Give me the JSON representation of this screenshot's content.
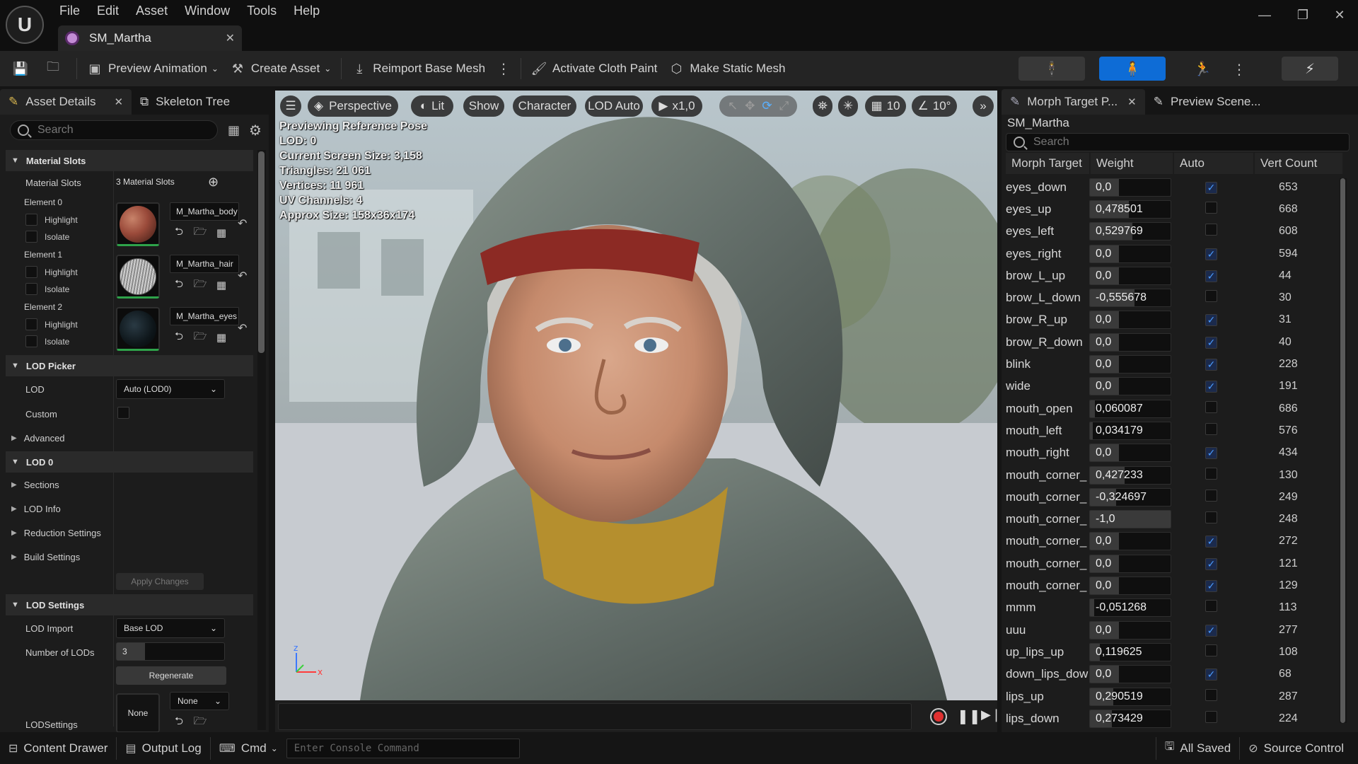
{
  "app": {
    "engine_logo": "U",
    "document_tab": "SM_Martha",
    "window_controls": [
      "minimize",
      "restore",
      "close"
    ]
  },
  "menu": [
    "File",
    "Edit",
    "Asset",
    "Window",
    "Tools",
    "Help"
  ],
  "toolbar": {
    "preview_animation": "Preview Animation",
    "create_asset": "Create Asset",
    "reimport": "Reimport Base Mesh",
    "cloth_paint": "Activate Cloth Paint",
    "make_static": "Make Static Mesh"
  },
  "left_tabs": {
    "details": "Asset Details",
    "skeleton": "Skeleton Tree"
  },
  "left_search_placeholder": "Search",
  "material_slots": {
    "section": "Material Slots",
    "label": "Material Slots",
    "value": "3 Material Slots",
    "elements": [
      {
        "label": "Element 0",
        "highlight": "Highlight",
        "isolate": "Isolate",
        "material": "M_Martha_body",
        "color": "#9a4a3a"
      },
      {
        "label": "Element 1",
        "highlight": "Highlight",
        "isolate": "Isolate",
        "material": "M_Martha_hair",
        "color": "#b8b8b8"
      },
      {
        "label": "Element 2",
        "highlight": "Highlight",
        "isolate": "Isolate",
        "material": "M_Martha_eyes",
        "color": "#1a2a30"
      }
    ]
  },
  "lod_picker": {
    "section": "LOD Picker",
    "lod_label": "LOD",
    "lod_value": "Auto (LOD0)",
    "custom_label": "Custom",
    "advanced": "Advanced"
  },
  "lod0": {
    "section": "LOD 0",
    "items": [
      "Sections",
      "LOD Info",
      "Reduction Settings",
      "Build Settings"
    ],
    "apply": "Apply Changes"
  },
  "lod_settings": {
    "section": "LOD Settings",
    "import_label": "LOD Import",
    "import_value": "Base LOD",
    "num_label": "Number of LODs",
    "num_value": "3",
    "regenerate": "Regenerate",
    "settings_label": "LODSettings",
    "settings_asset": "None",
    "settings_dropdown": "None"
  },
  "viewport": {
    "buttons": {
      "perspective": "Perspective",
      "lit": "Lit",
      "show": "Show",
      "character": "Character",
      "lod": "LOD Auto",
      "speed": "x1,0",
      "grid": "10",
      "angle": "10°"
    },
    "stats": [
      "Previewing Reference Pose",
      "LOD: 0",
      "Current Screen Size: 3,158",
      "Triangles: 21 061",
      "Vertices: 11 961",
      "UV Channels: 4",
      "Approx Size: 158x36x174"
    ]
  },
  "right_tabs": {
    "morph": "Morph Target P...",
    "scene": "Preview Scene..."
  },
  "morph": {
    "asset": "SM_Martha",
    "search_placeholder": "Search",
    "headers": {
      "name": "Morph Target",
      "weight": "Weight",
      "auto": "Auto",
      "vert": "Vert Count"
    },
    "rows": [
      {
        "name": "eyes_down",
        "weight": "0,0",
        "w": 0,
        "auto": true,
        "verts": "653"
      },
      {
        "name": "eyes_up",
        "weight": "0,478501",
        "w": 0.478501,
        "auto": false,
        "verts": "668"
      },
      {
        "name": "eyes_left",
        "weight": "0,529769",
        "w": 0.529769,
        "auto": false,
        "verts": "608"
      },
      {
        "name": "eyes_right",
        "weight": "0,0",
        "w": 0,
        "auto": true,
        "verts": "594"
      },
      {
        "name": "brow_L_up",
        "weight": "0,0",
        "w": 0,
        "auto": true,
        "verts": "44"
      },
      {
        "name": "brow_L_down",
        "weight": "-0,555678",
        "w": -0.555678,
        "auto": false,
        "verts": "30"
      },
      {
        "name": "brow_R_up",
        "weight": "0,0",
        "w": 0,
        "auto": true,
        "verts": "31"
      },
      {
        "name": "brow_R_down",
        "weight": "0,0",
        "w": 0,
        "auto": true,
        "verts": "40"
      },
      {
        "name": "blink",
        "weight": "0,0",
        "w": 0,
        "auto": true,
        "verts": "228"
      },
      {
        "name": "wide",
        "weight": "0,0",
        "w": 0,
        "auto": true,
        "verts": "191"
      },
      {
        "name": "mouth_open",
        "weight": "0,060087",
        "w": 0.060087,
        "auto": false,
        "verts": "686"
      },
      {
        "name": "mouth_left",
        "weight": "0,034179",
        "w": 0.034179,
        "auto": false,
        "verts": "576"
      },
      {
        "name": "mouth_right",
        "weight": "0,0",
        "w": 0,
        "auto": true,
        "verts": "434"
      },
      {
        "name": "mouth_corner_",
        "weight": "0,427233",
        "w": 0.427233,
        "auto": false,
        "verts": "130"
      },
      {
        "name": "mouth_corner_",
        "weight": "-0,324697",
        "w": -0.324697,
        "auto": false,
        "verts": "249"
      },
      {
        "name": "mouth_corner_",
        "weight": "-1,0",
        "w": -1,
        "auto": false,
        "verts": "248"
      },
      {
        "name": "mouth_corner_",
        "weight": "0,0",
        "w": 0,
        "auto": true,
        "verts": "272"
      },
      {
        "name": "mouth_corner_",
        "weight": "0,0",
        "w": 0,
        "auto": true,
        "verts": "121"
      },
      {
        "name": "mouth_corner_",
        "weight": "0,0",
        "w": 0,
        "auto": true,
        "verts": "129"
      },
      {
        "name": "mmm",
        "weight": "-0,051268",
        "w": -0.051268,
        "auto": false,
        "verts": "113"
      },
      {
        "name": "uuu",
        "weight": "0,0",
        "w": 0,
        "auto": true,
        "verts": "277"
      },
      {
        "name": "up_lips_up",
        "weight": "0,119625",
        "w": 0.119625,
        "auto": false,
        "verts": "108"
      },
      {
        "name": "down_lips_dow",
        "weight": "0,0",
        "w": 0,
        "auto": true,
        "verts": "68"
      },
      {
        "name": "lips_up",
        "weight": "0,290519",
        "w": 0.290519,
        "auto": false,
        "verts": "287"
      },
      {
        "name": "lips_down",
        "weight": "0,273429",
        "w": 0.273429,
        "auto": false,
        "verts": "224"
      }
    ]
  },
  "status": {
    "drawer": "Content Drawer",
    "log": "Output Log",
    "cmd": "Cmd",
    "console_placeholder": "Enter Console Command",
    "saved": "All Saved",
    "source": "Source Control"
  },
  "colors": {
    "accent": "#0e6cd6",
    "check": "#4b9bff",
    "record": "#e03030"
  }
}
